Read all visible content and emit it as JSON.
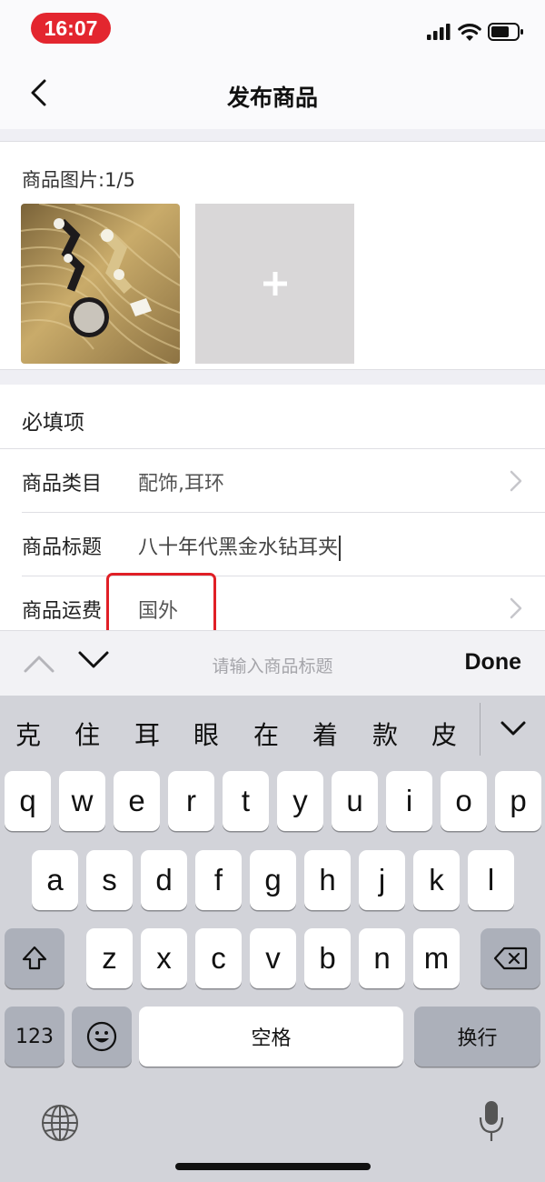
{
  "status_bar": {
    "time": "16:07"
  },
  "nav": {
    "title": "发布商品"
  },
  "images": {
    "label": "商品图片:1/5",
    "add_symbol": "+"
  },
  "form": {
    "section_title": "必填项",
    "rows": [
      {
        "label": "商品类目",
        "value": "配饰,耳环"
      },
      {
        "label": "商品标题",
        "value": "八十年代黑金水钻耳夹"
      },
      {
        "label": "商品运费",
        "value": "国外"
      }
    ]
  },
  "accessory": {
    "placeholder": "请输入商品标题",
    "done_label": "Done"
  },
  "keyboard": {
    "candidates": [
      "克",
      "住",
      "耳",
      "眼",
      "在",
      "着",
      "款",
      "皮"
    ],
    "row1": [
      "q",
      "w",
      "e",
      "r",
      "t",
      "y",
      "u",
      "i",
      "o",
      "p"
    ],
    "row2": [
      "a",
      "s",
      "d",
      "f",
      "g",
      "h",
      "j",
      "k",
      "l"
    ],
    "row3": [
      "z",
      "x",
      "c",
      "v",
      "b",
      "n",
      "m"
    ],
    "numbers_label": "123",
    "space_label": "空格",
    "return_label": "换行"
  },
  "colors": {
    "time_pill": "#e3262f",
    "highlight": "#e01f26",
    "keyboard_bg": "#d2d3d9"
  }
}
